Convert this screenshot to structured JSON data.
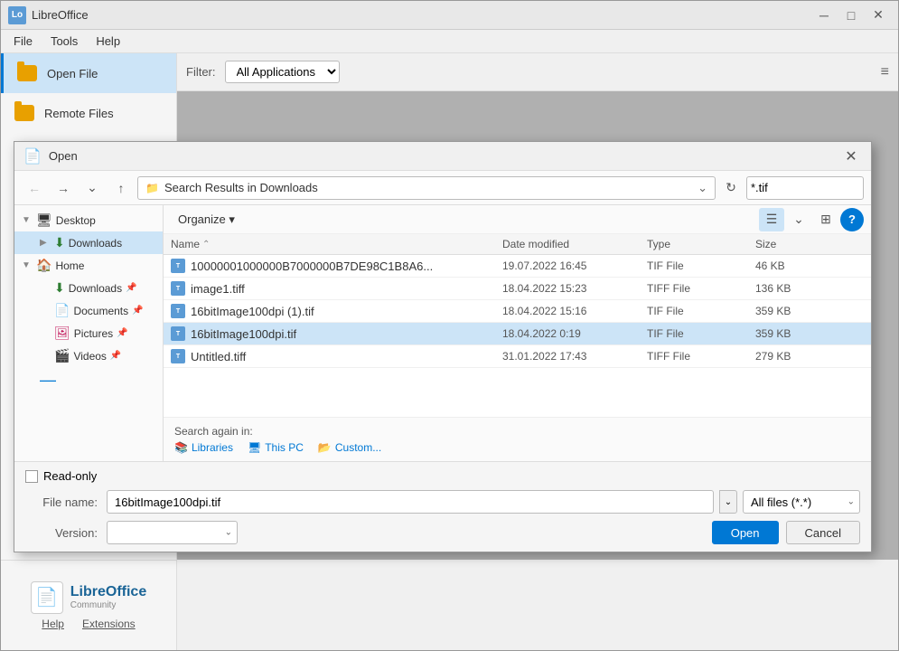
{
  "app": {
    "title": "LibreOffice",
    "logo_text": "LibreOffice",
    "logo_sub": "Community"
  },
  "window_controls": {
    "minimize": "─",
    "maximize": "□",
    "close": "✕"
  },
  "menubar": {
    "items": [
      "File",
      "Tools",
      "Help"
    ]
  },
  "sidebar": {
    "open_file_label": "Open File",
    "remote_files_label": "Remote Files",
    "bottom_links": [
      "Help",
      "Extensions"
    ]
  },
  "filter_bar": {
    "filter_label": "Filter:",
    "filter_value": "All Applications",
    "menu_icon": "≡"
  },
  "dialog": {
    "title": "Open",
    "close_btn": "✕",
    "address": "Search Results in Downloads",
    "search_value": "*.tif",
    "organize_label": "Organize ▾",
    "columns": {
      "name": "Name",
      "date_modified": "Date modified",
      "type": "Type",
      "size": "Size"
    },
    "files": [
      {
        "name": "10000001000000B7000000B7DE98C1B8A6...",
        "date": "19.07.2022 16:45",
        "type": "TIF File",
        "size": "46 KB",
        "selected": false
      },
      {
        "name": "image1.tiff",
        "date": "18.04.2022 15:23",
        "type": "TIFF File",
        "size": "136 KB",
        "selected": false
      },
      {
        "name": "16bitImage100dpi (1).tif",
        "date": "18.04.2022 15:16",
        "type": "TIF File",
        "size": "359 KB",
        "selected": false
      },
      {
        "name": "16bitImage100dpi.tif",
        "date": "18.04.2022 0:19",
        "type": "TIF File",
        "size": "359 KB",
        "selected": true
      },
      {
        "name": "Untitled.tiff",
        "date": "31.01.2022 17:43",
        "type": "TIFF File",
        "size": "279 KB",
        "selected": false
      }
    ],
    "search_again_label": "Search again in:",
    "search_again_links": [
      "Libraries",
      "This PC",
      "Custom..."
    ],
    "readonly_label": "Read-only",
    "filename_label": "File name:",
    "filename_value": "16bitImage100dpi.tif",
    "filetype_label": "All files (*.*)",
    "version_label": "Version:",
    "open_btn": "Open",
    "cancel_btn": "Cancel",
    "left_tree": [
      {
        "label": "Desktop",
        "level": 0,
        "expanded": true,
        "icon": "🖥"
      },
      {
        "label": "Downloads",
        "level": 1,
        "expanded": true,
        "icon": "⬇",
        "selected": true
      },
      {
        "label": "Home",
        "level": 0,
        "expanded": true,
        "icon": "🏠"
      },
      {
        "label": "Downloads",
        "level": 1,
        "icon": "⬇"
      },
      {
        "label": "Documents",
        "level": 1,
        "icon": "📄"
      },
      {
        "label": "Pictures",
        "level": 1,
        "icon": "🖼"
      },
      {
        "label": "Videos",
        "level": 1,
        "icon": "🎬"
      }
    ]
  }
}
